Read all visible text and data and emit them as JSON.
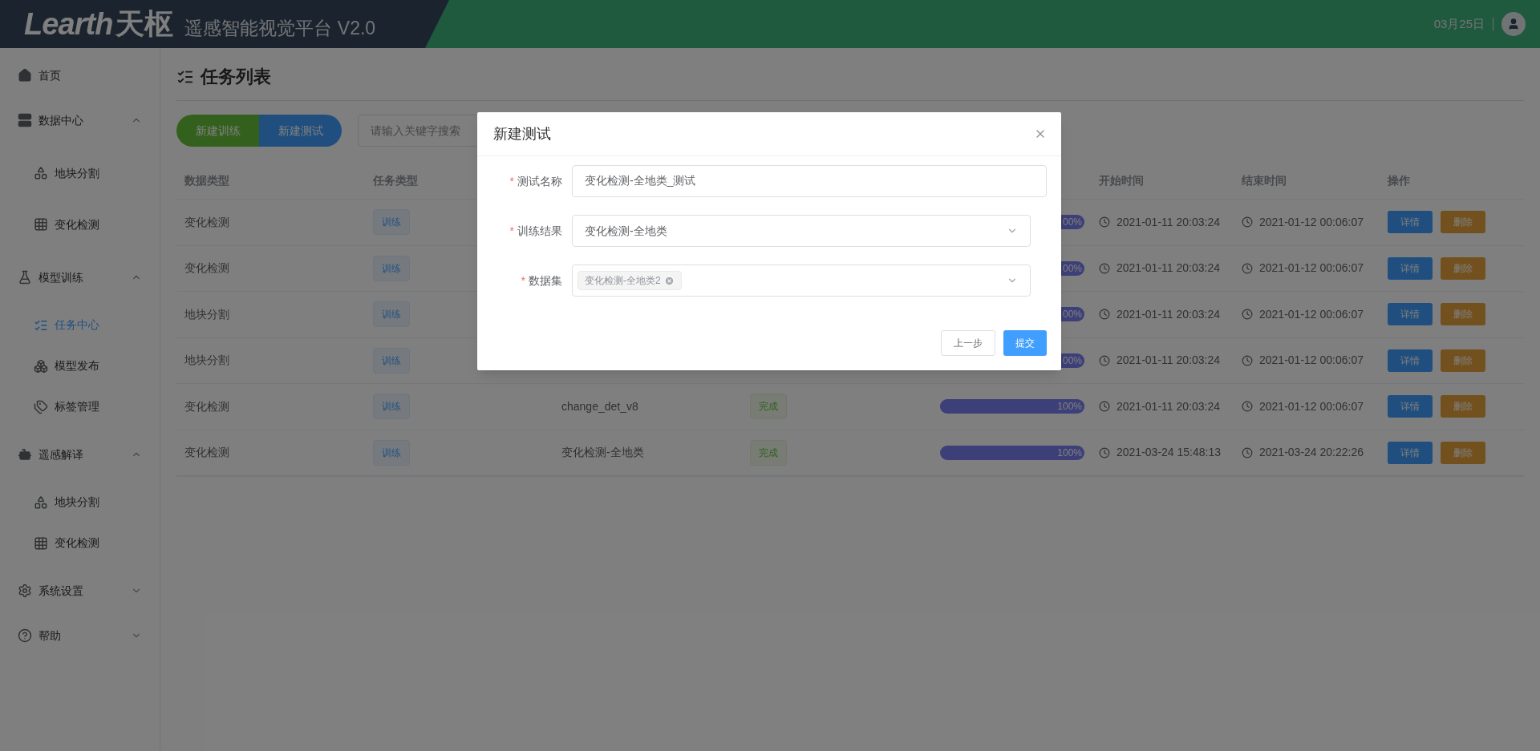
{
  "header": {
    "logo": "Learth",
    "logo_cn": "天枢",
    "subtitle": "遥感智能视觉平台 V2.0",
    "date": "03月25日"
  },
  "sidebar": {
    "items": [
      {
        "label": "首页",
        "selected": false
      },
      {
        "label": "数据中心",
        "selected": false,
        "expanded": true,
        "children": [
          {
            "label": "地块分割",
            "selected": false
          },
          {
            "label": "变化检测",
            "selected": false
          }
        ]
      },
      {
        "label": "模型训练",
        "selected": false,
        "expanded": true,
        "children": [
          {
            "label": "任务中心",
            "selected": true
          },
          {
            "label": "模型发布",
            "selected": false
          },
          {
            "label": "标签管理",
            "selected": false
          }
        ]
      },
      {
        "label": "遥感解译",
        "selected": false,
        "expanded": true,
        "children": [
          {
            "label": "地块分割",
            "selected": false
          },
          {
            "label": "变化检测",
            "selected": false
          }
        ]
      },
      {
        "label": "系统设置",
        "selected": false,
        "expanded": false
      },
      {
        "label": "帮助",
        "selected": false,
        "expanded": false
      }
    ]
  },
  "page": {
    "title": "任务列表",
    "buttons": [
      {
        "label": "新建训练",
        "kind": "success"
      },
      {
        "label": "新建测试",
        "kind": "primary"
      }
    ],
    "search": {
      "placeholder": "请输入关键字搜索"
    }
  },
  "table": {
    "columns": [
      "数据类型",
      "任务类型",
      null,
      null,
      null,
      "开始时间",
      "结束时间",
      "操作"
    ],
    "rows": [
      {
        "data_type": "变化检测",
        "task_type": "训练",
        "progress": {
          "level": 1,
          "label": "00%"
        },
        "start": "2021-01-11 20:03:24",
        "end": "2021-01-12 00:06:07",
        "actions": [
          "详情",
          "删除"
        ]
      },
      {
        "data_type": "变化检测",
        "task_type": "训练",
        "progress": {
          "level": 1,
          "label": "00%"
        },
        "start": "2021-01-11 20:03:24",
        "end": "2021-01-12 00:06:07",
        "actions": [
          "详情",
          "删除"
        ]
      },
      {
        "data_type": "地块分割",
        "task_type": "训练",
        "progress": {
          "level": 1,
          "label": "00%"
        },
        "start": "2021-01-11 20:03:24",
        "end": "2021-01-12 00:06:07",
        "actions": [
          "详情",
          "删除"
        ]
      },
      {
        "data_type": "地块分割",
        "task_type": "训练",
        "progress": {
          "level": 1,
          "label": "00%"
        },
        "start": "2021-01-11 20:03:24",
        "end": "2021-01-12 00:06:07",
        "actions": [
          "详情",
          "删除"
        ]
      },
      {
        "data_type": "变化检测",
        "task_type": "训练",
        "name": "change_det_v8",
        "status": "完成",
        "progress": {
          "level": 1,
          "label": "100%"
        },
        "start": "2021-01-11 20:03:24",
        "end": "2021-01-12 00:06:07",
        "actions": [
          "详情",
          "删除"
        ]
      },
      {
        "data_type": "变化检测",
        "task_type": "训练",
        "name": "变化检测-全地类",
        "status": "完成",
        "progress": {
          "level": 1,
          "label": "100%"
        },
        "start": "2021-03-24 15:48:13",
        "end": "2021-03-24 20:22:26",
        "actions": [
          "详情",
          "删除"
        ]
      }
    ]
  },
  "dialog": {
    "title": "新建测试",
    "fields": [
      {
        "label": "测试名称",
        "required_mark": "*",
        "kind": "input",
        "value": "变化检测-全地类_测试"
      },
      {
        "label": "训练结果",
        "required_mark": "*",
        "kind": "select",
        "value": "变化检测-全地类"
      },
      {
        "label": "数据集",
        "required_mark": "*",
        "kind": "multiselect",
        "tags": [
          "变化检测-全地类2"
        ]
      }
    ],
    "buttons": [
      {
        "label": "上一步",
        "kind": "default"
      },
      {
        "label": "提交",
        "kind": "primary"
      }
    ]
  }
}
